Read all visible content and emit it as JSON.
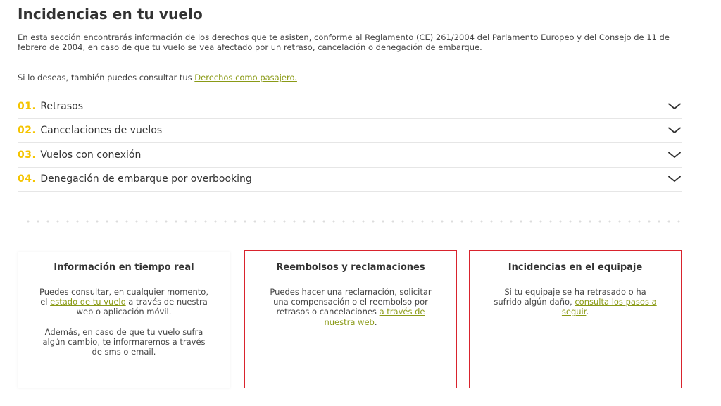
{
  "page": {
    "title": "Incidencias en tu vuelo",
    "intro": "En esta sección encontrarás información de los derechos que te asisten, conforme al Reglamento (CE) 261/2004 del Parlamento Europeo y del Consejo de 11 de febrero de 2004, en caso de que tu vuelo se vea afectado por un retraso, cancelación o denegación de embarque.",
    "consult_prefix": "Si lo deseas, también puedes consultar tus ",
    "consult_link": "Derechos como pasajero."
  },
  "accordion": [
    {
      "num": "01.",
      "label": "Retrasos"
    },
    {
      "num": "02.",
      "label": "Cancelaciones de vuelos"
    },
    {
      "num": "03.",
      "label": "Vuelos con conexión"
    },
    {
      "num": "04.",
      "label": "Denegación de embarque por overbooking"
    }
  ],
  "cards": {
    "realtime": {
      "title": "Información en tiempo real",
      "p1_prefix": "Puedes consultar, en cualquier momento, el ",
      "p1_link": "estado de tu vuelo",
      "p1_suffix": " a través de nuestra web o aplicación móvil.",
      "p2": "Además, en caso de que tu vuelo sufra algún cambio, te informaremos a través de sms o email."
    },
    "refunds": {
      "title": "Reembolsos y reclamaciones",
      "body_prefix": "Puedes hacer una reclamación, solicitar una compensación o el reembolso por retrasos o cancelaciones ",
      "body_link": "a través de nuestra web",
      "body_suffix": "."
    },
    "baggage": {
      "title": "Incidencias en el equipaje",
      "body_prefix": "Si tu equipaje se ha retrasado o ha sufrido algún daño, ",
      "body_link": "consulta los pasos a seguir",
      "body_suffix": "."
    }
  },
  "colors": {
    "accent_number": "#f5c400",
    "link": "#8a9a16",
    "highlight_border": "#d9232d",
    "text": "#333333"
  },
  "icons": {
    "accordion_toggle": "chevron-down-icon"
  }
}
